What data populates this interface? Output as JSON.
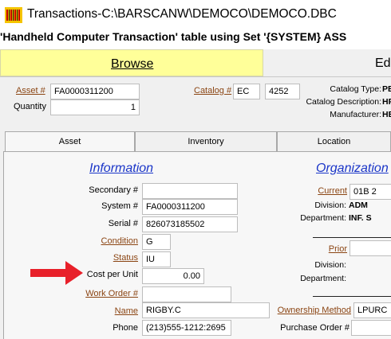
{
  "window": {
    "title": "Transactions-C:\\BARSCANW\\DEMOCO\\DEMOCO.DBC",
    "icon": "barcode-app-icon"
  },
  "subtitle": "'Handheld Computer Transaction' table using Set '{SYSTEM} ASS",
  "main_tabs": {
    "browse": "Browse",
    "edit": "Ed"
  },
  "header": {
    "asset_label": "Asset #",
    "asset_value": "FA0000311200",
    "quantity_label": "Quantity",
    "quantity_value": "1",
    "catalog_label": "Catalog #",
    "catalog_code": "EC",
    "catalog_number": "4252",
    "catalog_type_label": "Catalog Type:",
    "catalog_type_value": "PE",
    "catalog_desc_label": "Catalog Description:",
    "catalog_desc_value": "HP",
    "manufacturer_label": "Manufacturer:",
    "manufacturer_value": "HE"
  },
  "inner_tabs": {
    "asset": "Asset",
    "inventory": "Inventory",
    "location": "Location"
  },
  "information": {
    "heading": "Information",
    "secondary_label": "Secondary #",
    "secondary_value": "",
    "system_label": "System #",
    "system_value": "FA0000311200",
    "serial_label": "Serial #",
    "serial_value": "826073185502",
    "condition_label": "Condition",
    "condition_value": "G",
    "status_label": "Status",
    "status_value": "IU",
    "cost_label": "Cost per Unit",
    "cost_value": "0.00",
    "workorder_label": "Work Order #",
    "workorder_value": "",
    "name_label": "Name",
    "name_value": "RIGBY.C",
    "phone_label": "Phone",
    "phone_value": "(213)555-1212:2695"
  },
  "organization": {
    "heading": "Organization",
    "current_label": "Current",
    "current_value": "01B 2",
    "division_label": "Division:",
    "division_value": "ADM",
    "department_label": "Department:",
    "department_value": "INF. S",
    "prior_label": "Prior",
    "prior_value": "",
    "prior_division_label": "Division:",
    "prior_department_label": "Department:",
    "ownership_label": "Ownership Method",
    "ownership_value": "LPURC",
    "purchase_order_label": "Purchase Order #",
    "purchase_order_value": ""
  },
  "colors": {
    "browse_tab": "#ffff99",
    "link": "#8b4513",
    "section_heading": "#1a35c8",
    "arrow": "#e8202a"
  }
}
